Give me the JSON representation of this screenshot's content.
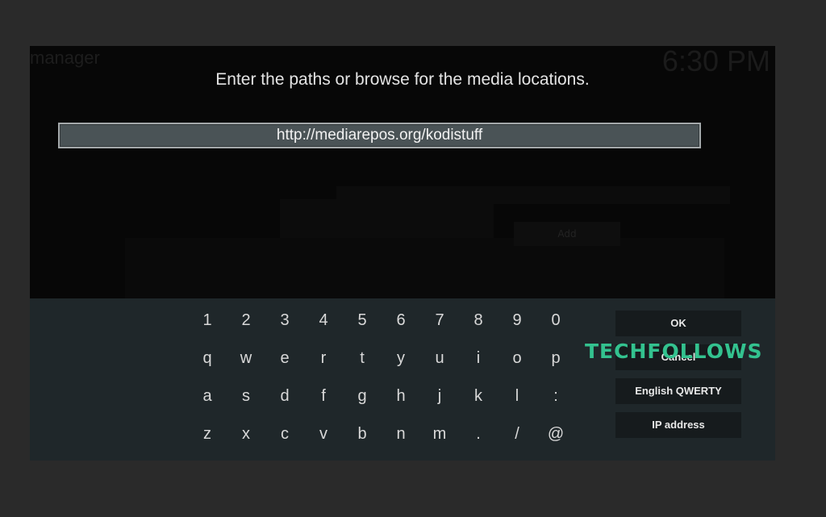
{
  "background": {
    "window_title": "manager",
    "clock": "6:30 PM",
    "add_label": "Add"
  },
  "dialog": {
    "heading": "Enter the paths or browse for the media locations.",
    "path_value": "http://mediarepos.org/kodistuff"
  },
  "keyboard": {
    "rows": [
      [
        "1",
        "2",
        "3",
        "4",
        "5",
        "6",
        "7",
        "8",
        "9",
        "0"
      ],
      [
        "q",
        "w",
        "e",
        "r",
        "t",
        "y",
        "u",
        "i",
        "o",
        "p"
      ],
      [
        "a",
        "s",
        "d",
        "f",
        "g",
        "h",
        "j",
        "k",
        "l",
        ":"
      ],
      [
        "z",
        "x",
        "c",
        "v",
        "b",
        "n",
        "m",
        ".",
        "/",
        "@"
      ]
    ],
    "buttons": {
      "ok": "OK",
      "cancel": "Cancel",
      "layout": "English QWERTY",
      "ip": "IP address"
    }
  },
  "watermark": "TECHFOLLOWS",
  "colors": {
    "keyboard_bg": "#1f272a",
    "input_bg": "#4a5356",
    "watermark": "#33c28f"
  }
}
